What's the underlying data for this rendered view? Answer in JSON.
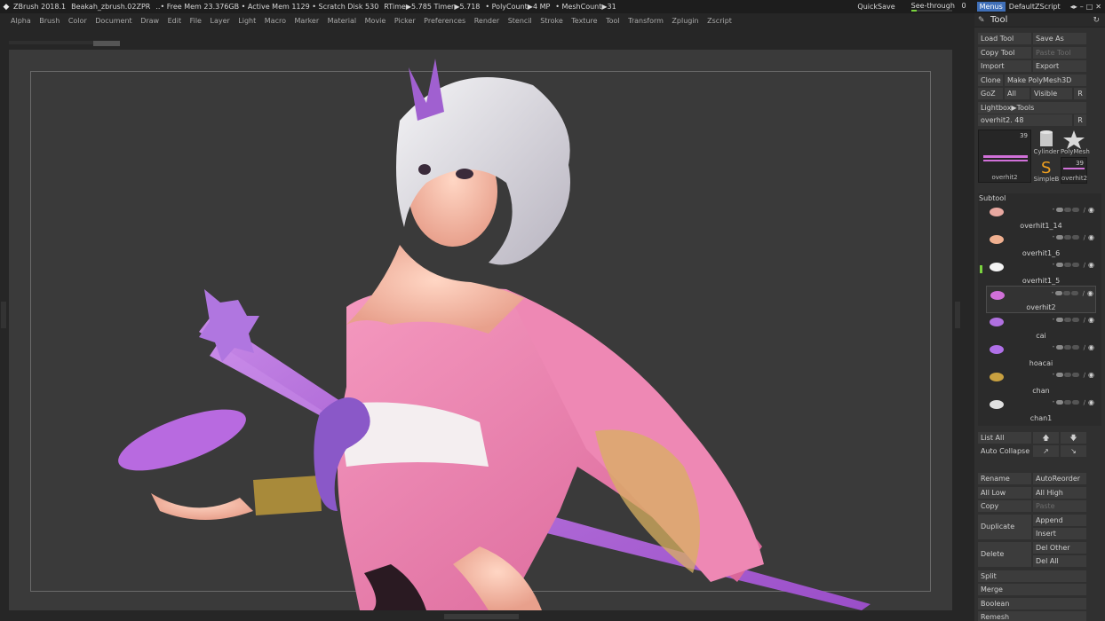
{
  "titlebar": {
    "app": "ZBrush 2018.1",
    "file": "Beakah_zbrush.02ZPR",
    "status": "..• Free Mem 23.376GB • Active Mem 1129 • Scratch Disk 530",
    "rtime": "RTime▶5.785 Timer▶5.718",
    "polycount": "• PolyCount▶4 MP",
    "meshcount": "• MeshCount▶31",
    "quicksave": "QuickSave",
    "seethrough": "See-through",
    "seethrough_value": "0",
    "menus": "Menus",
    "defaultzscript": "DefaultZScript",
    "window_controls": [
      "◂▸",
      "–",
      "□",
      "✕"
    ]
  },
  "menu": [
    "Alpha",
    "Brush",
    "Color",
    "Document",
    "Draw",
    "Edit",
    "File",
    "Layer",
    "Light",
    "Macro",
    "Marker",
    "Material",
    "Movie",
    "Picker",
    "Preferences",
    "Render",
    "Stencil",
    "Stroke",
    "Texture",
    "Tool",
    "Transform",
    "Zplugin",
    "Zscript"
  ],
  "tool_panel": {
    "title": "Tool",
    "load_tool": "Load Tool",
    "save_as": "Save As",
    "copy_tool": "Copy Tool",
    "paste_tool": "Paste Tool",
    "import": "Import",
    "export": "Export",
    "clone": "Clone",
    "make_polymesh": "Make PolyMesh3D",
    "goz": "GoZ",
    "all": "All",
    "visible": "Visible",
    "r": "R",
    "lightbox_tools": "Lightbox▶Tools",
    "current_tool": "overhit2. 48",
    "thumbs": [
      {
        "name": "overhit2",
        "count": "39"
      },
      {
        "name": "Cylinder",
        "count": ""
      },
      {
        "name": "PolyMesh",
        "count": ""
      },
      {
        "name": "SimpleB",
        "count": ""
      },
      {
        "name": "overhit2",
        "count": "39"
      }
    ]
  },
  "subtool": {
    "title": "Subtool",
    "items": [
      {
        "name": "overhit1_14",
        "color": "#e8a8a0"
      },
      {
        "name": "overhit1_6",
        "color": "#f0b090"
      },
      {
        "name": "overhit1_5",
        "color": "#f4f4f4"
      },
      {
        "name": "overhit2",
        "color": "#d070d8"
      },
      {
        "name": "cai",
        "color": "#b070e0"
      },
      {
        "name": "hoacai",
        "color": "#b070e8"
      },
      {
        "name": "chan",
        "color": "#c8a040"
      },
      {
        "name": "chan1",
        "color": "#e0e0e0"
      }
    ],
    "selected_index": 3
  },
  "lower_buttons": {
    "list_all": "List All",
    "auto_collapse": "Auto Collapse",
    "rename": "Rename",
    "autoreorder": "AutoReorder",
    "all_low": "All Low",
    "all_high": "All High",
    "copy": "Copy",
    "paste": "Paste",
    "duplicate": "Duplicate",
    "append": "Append",
    "insert": "Insert",
    "delete": "Delete",
    "del_other": "Del Other",
    "del_all": "Del All",
    "split": "Split",
    "merge": "Merge",
    "boolean": "Boolean",
    "remesh": "Remesh"
  },
  "colors": {
    "accent_green": "#7ad33f",
    "menus_blue": "#3f6fb8",
    "kimono_pink": "#e87aa8",
    "sword_purple": "#b068d8"
  }
}
